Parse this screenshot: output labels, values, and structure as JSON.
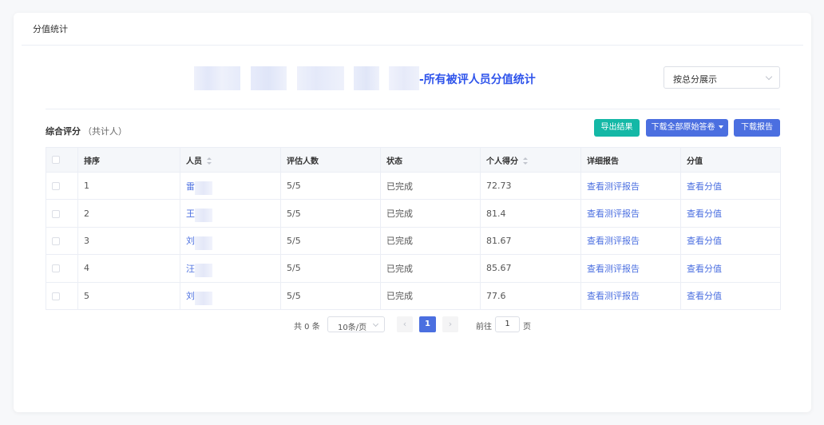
{
  "page": {
    "title": "分值统计",
    "heading_suffix": "-所有被评人员分值统计"
  },
  "display_select": {
    "value": "按总分展示"
  },
  "summary": {
    "label": "综合评分",
    "count_text": "（共计人）"
  },
  "actions": {
    "export": "导出结果",
    "download_all": "下载全部原始答卷",
    "download_report": "下载报告"
  },
  "table": {
    "columns": [
      "排序",
      "人员",
      "评估人数",
      "状态",
      "个人得分",
      "详细报告",
      "分值"
    ],
    "rows": [
      {
        "rank": "1",
        "person": "雷",
        "evaluators": "5/5",
        "status": "已完成",
        "score": "72.73",
        "report": "查看测评报告",
        "value": "查看分值"
      },
      {
        "rank": "2",
        "person": "王",
        "evaluators": "5/5",
        "status": "已完成",
        "score": "81.4",
        "report": "查看测评报告",
        "value": "查看分值"
      },
      {
        "rank": "3",
        "person": "刘",
        "evaluators": "5/5",
        "status": "已完成",
        "score": "81.67",
        "report": "查看测评报告",
        "value": "查看分值"
      },
      {
        "rank": "4",
        "person": "汪",
        "evaluators": "5/5",
        "status": "已完成",
        "score": "85.67",
        "report": "查看测评报告",
        "value": "查看分值"
      },
      {
        "rank": "5",
        "person": "刘",
        "evaluators": "5/5",
        "status": "已完成",
        "score": "77.6",
        "report": "查看测评报告",
        "value": "查看分值"
      }
    ]
  },
  "pagination": {
    "total": "共 0 条",
    "page_size": "10条/页",
    "current_page": "1",
    "goto_label": "前往",
    "goto_value": "1",
    "page_unit": "页",
    "prev_icon": "‹",
    "next_icon": "›"
  },
  "colors": {
    "primary": "#4b6fe0",
    "teal": "#14b8a6",
    "heading": "#2f54eb"
  }
}
